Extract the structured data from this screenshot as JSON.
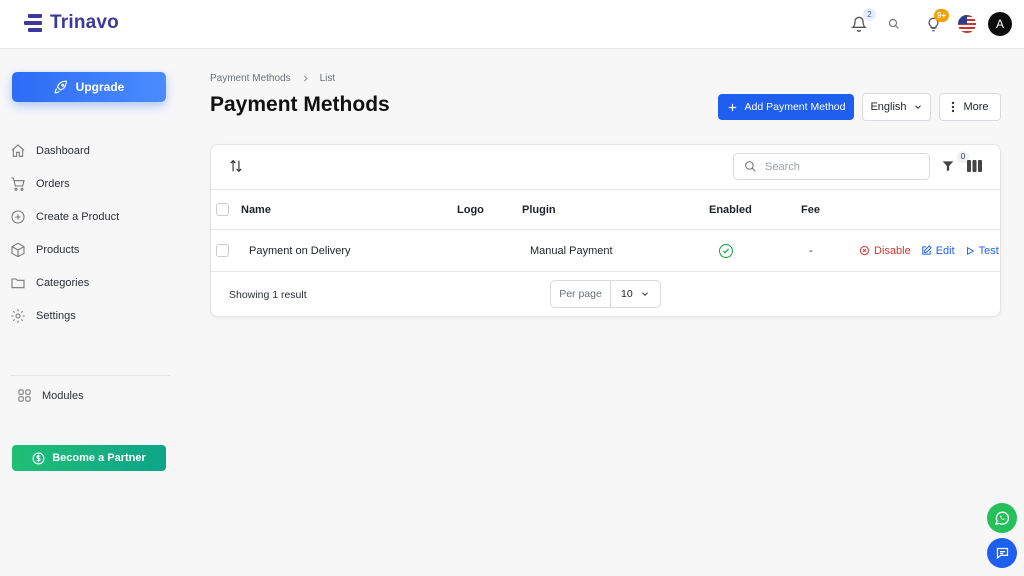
{
  "brand": {
    "name": "Trinavo",
    "color": "#3b3a9c"
  },
  "header": {
    "notifications_count": "2",
    "tips_count": "9+",
    "avatar_initial": "A"
  },
  "sidebar": {
    "upgrade_label": "Upgrade",
    "items": [
      {
        "label": "Dashboard",
        "icon": "home-icon"
      },
      {
        "label": "Orders",
        "icon": "cart-icon"
      },
      {
        "label": "Create a Product",
        "icon": "plus-circle-icon"
      },
      {
        "label": "Products",
        "icon": "box-icon"
      },
      {
        "label": "Categories",
        "icon": "folder-icon"
      },
      {
        "label": "Settings",
        "icon": "gear-icon"
      }
    ],
    "modules_label": "Modules",
    "partner_label": "Become a Partner"
  },
  "breadcrumb": {
    "items": [
      "Payment Methods",
      "List"
    ]
  },
  "page": {
    "title": "Payment Methods",
    "add_label": "Add Payment Method",
    "language": "English",
    "more_label": "More"
  },
  "table": {
    "search_placeholder": "Search",
    "filter_count": "0",
    "columns": [
      "Name",
      "Logo",
      "Plugin",
      "Enabled",
      "Fee"
    ],
    "rows": [
      {
        "name": "Payment on Delivery",
        "logo": "",
        "plugin": "Manual Payment",
        "enabled": true,
        "fee": "-",
        "actions": {
          "disable": "Disable",
          "edit": "Edit",
          "test": "Test"
        }
      }
    ],
    "footer": {
      "summary": "Showing 1 result",
      "per_page_label": "Per page",
      "per_page_value": "10"
    }
  },
  "colors": {
    "primary": "#1f5ff0",
    "success": "#16a34a",
    "danger": "#e03131",
    "partner": "#1fbf75"
  }
}
